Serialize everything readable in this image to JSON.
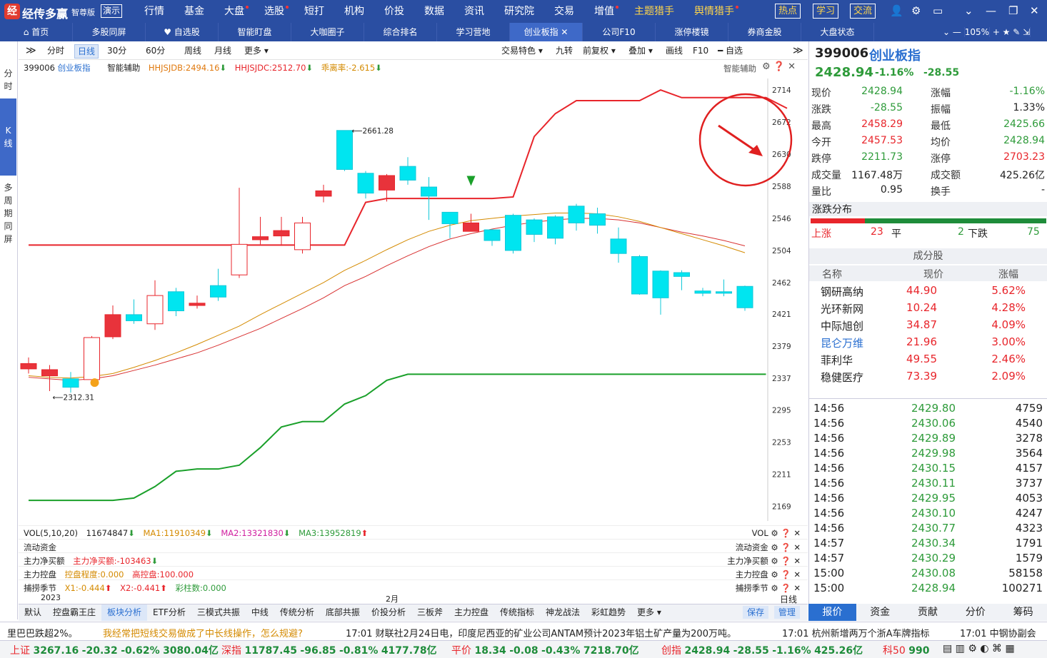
{
  "app": {
    "logo": "经",
    "brand": "经传多赢",
    "edition": "智尊版",
    "demo": "演示"
  },
  "menu": [
    {
      "t": "行情"
    },
    {
      "t": "基金"
    },
    {
      "t": "大盘",
      "dot": 1
    },
    {
      "t": "选股",
      "dot": 1
    },
    {
      "t": "短打"
    },
    {
      "t": "机构"
    },
    {
      "t": "价投"
    },
    {
      "t": "数据"
    },
    {
      "t": "资讯"
    },
    {
      "t": "研究院"
    },
    {
      "t": "交易"
    },
    {
      "t": "增值",
      "dot": 1
    },
    {
      "t": "主题猎手",
      "y": 1
    },
    {
      "t": "舆情猎手",
      "y": 1,
      "dot": 1
    }
  ],
  "tags": [
    "热点",
    "学习",
    "交流"
  ],
  "tabs": [
    "首页",
    "多股同屏",
    "自选股",
    "智能盯盘",
    "大咖圈子",
    "综合排名",
    "学习营地",
    "创业板指",
    "公司F10",
    "涨停楼镜",
    "券商金股",
    "大盘状态"
  ],
  "zoom": "105%",
  "side": {
    "a": "分\n时",
    "k": "K\n线",
    "m": "多\n周\n期\n同\n屏"
  },
  "toolbar": [
    "分时",
    "日线",
    "30分",
    "60分",
    "周线",
    "月线",
    "更多 ▾"
  ],
  "toolbar_right": [
    "交易特色 ▾",
    "九转",
    "前复权 ▾",
    "叠加 ▾",
    "画线",
    "F10",
    "━ 自选"
  ],
  "ind": {
    "code": "399006",
    "name": "创业板指",
    "assist": "智能辅助",
    "h1": "HHJSJDB:2494.16",
    "h2": "HHJSJDC:2512.70",
    "h3": "乖离率:-2.615",
    "right": "智能辅助"
  },
  "chart_data": {
    "type": "candlestick",
    "yticks": [
      2714,
      2672,
      2630,
      2588,
      2546,
      2504,
      2462,
      2421,
      2379,
      2337,
      2295,
      2253,
      2211,
      2169
    ],
    "ylim": [
      2150,
      2729
    ],
    "max_label": "2661.28",
    "min_label": "2312.31",
    "xlabels": [
      "2023",
      "2月"
    ],
    "xunit": "日线",
    "candles": [
      [
        2349,
        2356,
        2364,
        2343
      ],
      [
        2340,
        2348,
        2354,
        2320
      ],
      [
        2336,
        2325,
        2345,
        2318
      ],
      [
        2335,
        2390,
        2392,
        2332
      ],
      [
        2391,
        2420,
        2432,
        2388
      ],
      [
        2420,
        2412,
        2440,
        2408
      ],
      [
        2408,
        2445,
        2465,
        2400
      ],
      [
        2450,
        2425,
        2455,
        2418
      ],
      [
        2432,
        2435,
        2445,
        2428
      ],
      [
        2458,
        2443,
        2480,
        2438
      ],
      [
        2472,
        2512,
        2586,
        2468
      ],
      [
        2518,
        2522,
        2548,
        2512
      ],
      [
        2523,
        2530,
        2548,
        2510
      ],
      [
        2505,
        2540,
        2548,
        2500
      ],
      [
        2575,
        2582,
        2590,
        2567
      ],
      [
        2661,
        2610,
        2661,
        2608
      ],
      [
        2605,
        2579,
        2608,
        2572
      ],
      [
        2583,
        2602,
        2604,
        2568
      ],
      [
        2614,
        2596,
        2626,
        2590
      ],
      [
        2587,
        2575,
        2600,
        2544
      ],
      [
        2554,
        2539,
        2554,
        2520
      ],
      [
        2529,
        2540,
        2552,
        2532
      ],
      [
        2531,
        2517,
        2532,
        2510
      ],
      [
        2550,
        2504,
        2552,
        2500
      ],
      [
        2544,
        2525,
        2546,
        2515
      ],
      [
        2548,
        2520,
        2550,
        2512
      ],
      [
        2562,
        2540,
        2565,
        2530
      ],
      [
        2552,
        2537,
        2560,
        2526
      ],
      [
        2519,
        2500,
        2534,
        2488
      ],
      [
        2496,
        2447,
        2498,
        2446
      ],
      [
        2477,
        2442,
        2478,
        2420
      ],
      [
        2475,
        2470,
        2478,
        2452
      ],
      [
        2451,
        2448,
        2455,
        2444
      ],
      [
        2450,
        2448,
        2466,
        2444
      ],
      [
        2457,
        2429,
        2458,
        2425
      ]
    ],
    "upper": [
      2511,
      2511,
      2511,
      2511,
      2511,
      2511,
      2511,
      2511,
      2511,
      2511,
      2511,
      2511,
      2511,
      2511,
      2511,
      2511,
      2567,
      2572,
      2572,
      2572,
      2572,
      2572,
      2572,
      2574,
      2653,
      2683,
      2700,
      2700,
      2700,
      2700,
      2714,
      2704,
      2704,
      2704,
      2704,
      2704,
      2690
    ],
    "lower": [
      2177,
      2177,
      2177,
      2177,
      2177,
      2180,
      2195,
      2215,
      2218,
      2218,
      2223,
      2246,
      2273,
      2280,
      2280,
      2303,
      2314,
      2334,
      2342,
      2342,
      2342,
      2342,
      2342,
      2342,
      2342,
      2342,
      2342,
      2342,
      2342,
      2342,
      2342,
      2342,
      2342,
      2342,
      2342,
      2342
    ],
    "ma1": [
      2340,
      2338,
      2337,
      2339,
      2343,
      2351,
      2360,
      2370,
      2381,
      2393,
      2405,
      2420,
      2434,
      2448,
      2462,
      2478,
      2491,
      2505,
      2518,
      2529,
      2537,
      2543,
      2546,
      2549,
      2551,
      2553,
      2553,
      2552,
      2548,
      2542,
      2534,
      2526,
      2518,
      2510,
      2501
    ],
    "ma2": [
      2338,
      2336,
      2334,
      2336,
      2340,
      2347,
      2354,
      2362,
      2370,
      2380,
      2391,
      2402,
      2415,
      2428,
      2442,
      2458,
      2470,
      2484,
      2497,
      2509,
      2519,
      2526,
      2532,
      2537,
      2541,
      2544,
      2546,
      2546,
      2544,
      2540,
      2534,
      2528,
      2523,
      2517,
      2510
    ]
  },
  "vol": {
    "title": "VOL(5,10,20)",
    "val": "11674847",
    "ma1": "MA1:11910349",
    "ma2": "MA2:13321830",
    "ma3": "MA3:13952819",
    "right": "VOL"
  },
  "flow": {
    "title": "流动资金",
    "right": "流动资金"
  },
  "net": {
    "title": "主力净买额",
    "v": "主力净买额:-103463",
    "right": "主力净买额"
  },
  "ctrl": {
    "title": "主力控盘",
    "v1": "控盘程度:0.000",
    "v2": "高控盘:100.000",
    "right": "主力控盘"
  },
  "season": {
    "title": "捕捞季节",
    "v1": "X1:-0.444",
    "v2": "X2:-0.441",
    "v3": "彩柱数:0.000",
    "right": "捕捞季节"
  },
  "btabs": [
    "默认",
    "控盘霸王庄",
    "板块分析",
    "ETF分析",
    "三模式共振",
    "中线",
    "传统分析",
    "底部共振",
    "价投分析",
    "三板斧",
    "主力控盘",
    "传统指标",
    "神龙战法",
    "彩虹趋势",
    "更多 ▾"
  ],
  "bsave": [
    "保存",
    "管理"
  ],
  "quote": {
    "code": "399006",
    "name": "创业板指",
    "price": "2428.94",
    "pct": "-1.16%",
    "chg": "-28.55",
    "rows": [
      [
        "现价",
        "2428.94",
        "g",
        "涨幅",
        "-1.16%",
        "g"
      ],
      [
        "涨跌",
        "-28.55",
        "g",
        "振幅",
        "1.33%",
        ""
      ],
      [
        "最高",
        "2458.29",
        "r",
        "最低",
        "2425.66",
        "g"
      ],
      [
        "今开",
        "2457.53",
        "r",
        "均价",
        "2428.94",
        "g"
      ],
      [
        "跌停",
        "2211.73",
        "g",
        "涨停",
        "2703.23",
        "r"
      ],
      [
        "成交量",
        "1167.48万",
        "",
        "成交额",
        "425.26亿",
        ""
      ],
      [
        "量比",
        "0.95",
        "",
        "换手",
        "-",
        ""
      ]
    ],
    "dist_title": "涨跌分布",
    "up": "上涨",
    "upn": "23",
    "flat": "平",
    "flatn": "2",
    "down": "下跌",
    "downn": "75",
    "cons_title": "成分股",
    "cons_head": [
      "名称",
      "现价",
      "涨幅"
    ],
    "cons": [
      [
        "钢研高纳",
        "44.90",
        "5.62%"
      ],
      [
        "光环新网",
        "10.24",
        "4.28%"
      ],
      [
        "中际旭创",
        "34.87",
        "4.09%"
      ],
      [
        "昆仑万维",
        "21.96",
        "3.00%"
      ],
      [
        "菲利华",
        "49.55",
        "2.46%"
      ],
      [
        "稳健医疗",
        "73.39",
        "2.09%"
      ]
    ],
    "ticks": [
      [
        "14:56",
        "2429.80",
        "4759"
      ],
      [
        "14:56",
        "2430.06",
        "4540"
      ],
      [
        "14:56",
        "2429.89",
        "3278"
      ],
      [
        "14:56",
        "2429.98",
        "3564"
      ],
      [
        "14:56",
        "2430.15",
        "4157"
      ],
      [
        "14:56",
        "2430.11",
        "3737"
      ],
      [
        "14:56",
        "2429.95",
        "4053"
      ],
      [
        "14:56",
        "2430.10",
        "4247"
      ],
      [
        "14:56",
        "2430.77",
        "4323"
      ],
      [
        "14:57",
        "2430.34",
        "1791"
      ],
      [
        "14:57",
        "2430.29",
        "1579"
      ],
      [
        "15:00",
        "2430.08",
        "58158"
      ],
      [
        "15:00",
        "2428.94",
        "100271"
      ]
    ]
  },
  "rtab": [
    "报价",
    "资金",
    "贡献",
    "分价",
    "筹码"
  ],
  "news": [
    "里巴巴跌超2%。",
    "我经常把短线交易做成了中长线操作，怎么规避?",
    "17:01 财联社2月24日电，印度尼西亚的矿业公司ANTAM预计2023年铝土矿产量为200万吨。",
    "17:01 杭州新增两万个浙A车牌指标",
    "17:01 中钢协副会"
  ],
  "status": [
    {
      "n": "上证",
      "v": "3267.16",
      "c": "-20.32",
      "p": "-0.62%",
      "a": "3080.04亿"
    },
    {
      "n": "深指",
      "v": "11787.45",
      "c": "-96.85",
      "p": "-0.81%",
      "a": "4177.78亿"
    },
    {
      "n": "平价",
      "v": "18.34",
      "c": "-0.08",
      "p": "-0.43%",
      "a": "7218.70亿"
    },
    {
      "n": "创指",
      "v": "2428.94",
      "c": "-28.55",
      "p": "-1.16%",
      "a": "425.26亿"
    },
    {
      "n": "科50",
      "v": "990",
      "c": "",
      "p": "",
      "a": ""
    }
  ]
}
